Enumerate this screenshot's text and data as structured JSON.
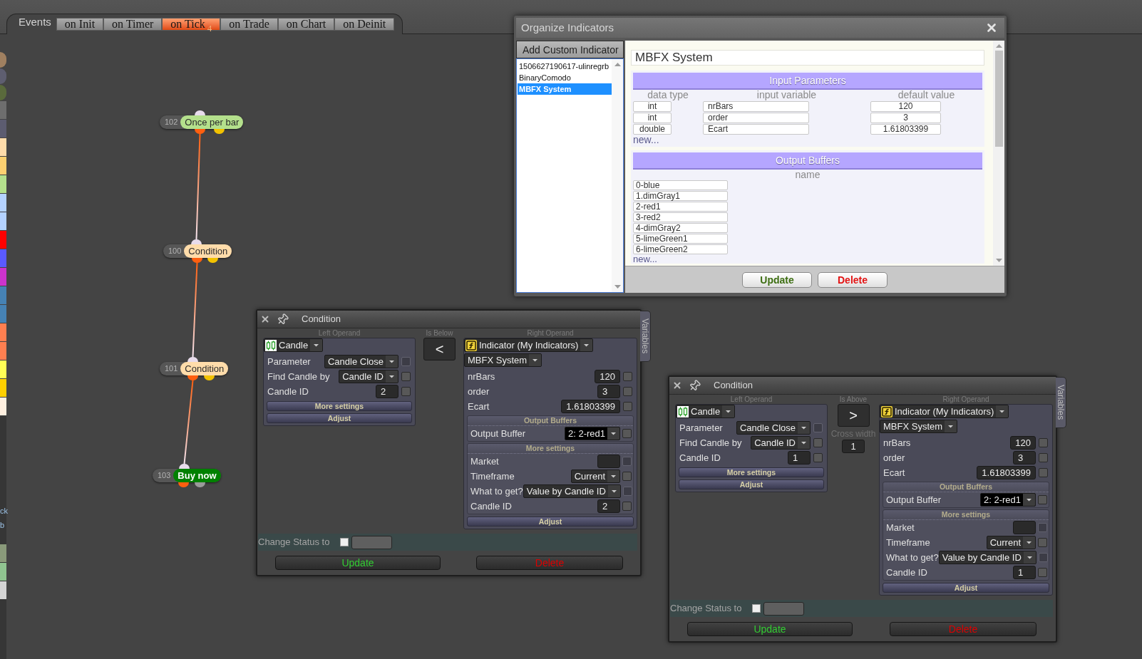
{
  "events_bar": {
    "label": "Events",
    "tabs": [
      {
        "label": "on Init",
        "selected": false
      },
      {
        "label": "on Timer",
        "selected": false
      },
      {
        "label": "on Tick",
        "selected": true,
        "badge": "4"
      },
      {
        "label": "on Trade",
        "selected": false
      },
      {
        "label": "on Chart",
        "selected": false
      },
      {
        "label": "on Deinit",
        "selected": false
      }
    ]
  },
  "palette": {
    "top": [
      {
        "kind": "dot",
        "color": "#a08060"
      },
      {
        "kind": "dot",
        "color": "#5e5e70"
      },
      {
        "kind": "dot",
        "color": "#5a6a3c"
      },
      {
        "kind": "swatch",
        "color": "#6e6e6e"
      },
      {
        "kind": "swatch",
        "color": "#5c5c70"
      },
      {
        "kind": "swatch",
        "color": "#ffdcaa"
      },
      {
        "kind": "swatch",
        "color": "#fcd070"
      },
      {
        "kind": "swatch",
        "color": "#b4e08c"
      },
      {
        "kind": "swatch",
        "color": "#b4d2ff"
      },
      {
        "kind": "swatch",
        "color": "#b4d2ff"
      },
      {
        "kind": "swatch",
        "color": "#ff0000"
      },
      {
        "kind": "swatch",
        "color": "#5a5aff"
      },
      {
        "kind": "swatch",
        "color": "#cc33cc"
      },
      {
        "kind": "swatch",
        "color": "#4682b4"
      },
      {
        "kind": "swatch",
        "color": "#4682b4"
      },
      {
        "kind": "swatch",
        "color": "#ff7f50"
      },
      {
        "kind": "swatch",
        "color": "#ff7f50"
      },
      {
        "kind": "swatch",
        "color": "#ffff55"
      },
      {
        "kind": "swatch",
        "color": "#ffd000"
      },
      {
        "kind": "swatch",
        "color": "#fff0e0"
      }
    ],
    "bottom": [
      {
        "kind": "text",
        "text": "ck"
      },
      {
        "kind": "text",
        "text": "b"
      },
      {
        "kind": "swatch",
        "color": "#8a9a7a"
      },
      {
        "kind": "swatch",
        "color": "#90c490"
      },
      {
        "kind": "swatch",
        "color": "#d4d4d4"
      }
    ]
  },
  "flow": {
    "nodes": [
      {
        "number": "102",
        "label": "Once per bar",
        "kind": "trigger",
        "color": "#b4e08c"
      },
      {
        "number": "100",
        "label": "Condition",
        "kind": "condition",
        "color": "#ffdcaa"
      },
      {
        "number": "101",
        "label": "Condition",
        "kind": "condition",
        "color": "#ffdcaa"
      },
      {
        "number": "103",
        "label": "Buy now",
        "kind": "action",
        "color": "#008000"
      }
    ]
  },
  "organize_window": {
    "title": "Organize Indicators",
    "add_button": "Add Custom Indicator",
    "indicators": [
      {
        "name": "1506627190617-ulinregrb",
        "selected": false
      },
      {
        "name": "BinaryComodo",
        "selected": false
      },
      {
        "name": "MBFX System",
        "selected": true
      }
    ],
    "name_field": "MBFX System",
    "input_parameters": {
      "title": "Input Parameters",
      "columns": [
        "data type",
        "input variable",
        "default value"
      ],
      "rows": [
        {
          "data_type": "int",
          "variable": "nrBars",
          "default": "120"
        },
        {
          "data_type": "int",
          "variable": "order",
          "default": "3"
        },
        {
          "data_type": "double",
          "variable": "Ecart",
          "default": "1.61803399"
        }
      ],
      "new_link": "new..."
    },
    "output_buffers": {
      "title": "Output Buffers",
      "column": "name",
      "rows": [
        "0-blue",
        "1.dimGray1",
        "2-red1",
        "3-red2",
        "4-dimGray2",
        "5-limeGreen1",
        "6-limeGreen2"
      ],
      "new_link": "new..."
    },
    "buttons": [
      {
        "kind": "update",
        "label": "Update"
      },
      {
        "kind": "delete",
        "label": "Delete"
      }
    ]
  },
  "condition_panels": [
    {
      "title": "Condition",
      "side_tab": "Variables",
      "left_operand": {
        "label": "Left Operand",
        "kind": "candle",
        "source": "Candle",
        "rows": [
          {
            "kind": "select",
            "label": "Parameter",
            "value": "Candle Close",
            "focused": false,
            "check_disabled": true
          },
          {
            "kind": "select",
            "label": "Find Candle by",
            "value": "Candle ID",
            "focused": false,
            "check_disabled": false
          },
          {
            "kind": "input",
            "label": "Candle ID",
            "value": "2",
            "check_disabled": false
          }
        ],
        "sections": [
          {
            "title": "More settings",
            "expanded": false
          },
          {
            "title": "Adjust",
            "expanded": false
          }
        ]
      },
      "operator": {
        "label": "Is Below",
        "symbol": "<"
      },
      "right_operand": {
        "label": "Right Operand",
        "kind": "indicator",
        "source": "Indicator (My Indicators)",
        "indicator": "MBFX System",
        "rows": [
          {
            "kind": "input",
            "label": "nrBars",
            "value": "120",
            "check_disabled": false
          },
          {
            "kind": "input",
            "label": "order",
            "value": "3",
            "check_disabled": false
          },
          {
            "kind": "input",
            "label": "Ecart",
            "value": "1.61803399",
            "check_disabled": false
          }
        ],
        "sections": [
          {
            "title": "Output Buffers",
            "expanded": true,
            "rows": [
              {
                "kind": "select",
                "label": "Output Buffer",
                "value": "2: 2-red1",
                "focused": true,
                "check_disabled": false
              }
            ]
          },
          {
            "title": "More settings",
            "expanded": true,
            "rows": [
              {
                "kind": "input",
                "label": "Market",
                "check_disabled": true
              },
              {
                "kind": "select",
                "label": "Timeframe",
                "value": "Current",
                "focused": false,
                "check_disabled": false
              },
              {
                "kind": "select",
                "label": "What to get?",
                "value": "Value by Candle ID",
                "focused": false,
                "check_disabled": true
              },
              {
                "kind": "input",
                "label": "Candle ID",
                "value": "2",
                "check_disabled": false
              }
            ]
          },
          {
            "title": "Adjust",
            "expanded": false
          }
        ]
      },
      "change_status": {
        "label": "Change Status to",
        "checked": false
      },
      "buttons": [
        {
          "kind": "update",
          "label": "Update"
        },
        {
          "kind": "delete",
          "label": "Delete"
        }
      ]
    },
    {
      "title": "Condition",
      "side_tab": "Variables",
      "left_operand": {
        "label": "Left Operand",
        "kind": "candle",
        "source": "Candle",
        "rows": [
          {
            "kind": "select",
            "label": "Parameter",
            "value": "Candle Close",
            "focused": false,
            "check_disabled": true
          },
          {
            "kind": "select",
            "label": "Find Candle by",
            "value": "Candle ID",
            "focused": false,
            "check_disabled": false
          },
          {
            "kind": "input",
            "label": "Candle ID",
            "value": "1",
            "check_disabled": false
          }
        ],
        "sections": [
          {
            "title": "More settings",
            "expanded": false
          },
          {
            "title": "Adjust",
            "expanded": false
          }
        ]
      },
      "operator": {
        "label": "Is Above",
        "symbol": ">",
        "cross_width": {
          "label": "Cross width",
          "value": "1"
        }
      },
      "right_operand": {
        "label": "Right Operand",
        "kind": "indicator",
        "source": "Indicator (My Indicators)",
        "indicator": "MBFX System",
        "rows": [
          {
            "kind": "input",
            "label": "nrBars",
            "value": "120",
            "check_disabled": false
          },
          {
            "kind": "input",
            "label": "order",
            "value": "3",
            "check_disabled": false
          },
          {
            "kind": "input",
            "label": "Ecart",
            "value": "1.61803399",
            "check_disabled": false
          }
        ],
        "sections": [
          {
            "title": "Output Buffers",
            "expanded": true,
            "rows": [
              {
                "kind": "select",
                "label": "Output Buffer",
                "value": "2: 2-red1",
                "focused": true,
                "check_disabled": false
              }
            ]
          },
          {
            "title": "More settings",
            "expanded": true,
            "rows": [
              {
                "kind": "input",
                "label": "Market",
                "check_disabled": true
              },
              {
                "kind": "select",
                "label": "Timeframe",
                "value": "Current",
                "focused": false,
                "check_disabled": false
              },
              {
                "kind": "select",
                "label": "What to get?",
                "value": "Value by Candle ID",
                "focused": false,
                "check_disabled": true
              },
              {
                "kind": "input",
                "label": "Candle ID",
                "value": "1",
                "check_disabled": false
              }
            ]
          },
          {
            "title": "Adjust",
            "expanded": false
          }
        ]
      },
      "change_status": {
        "label": "Change Status to",
        "checked": false
      },
      "buttons": [
        {
          "kind": "update",
          "label": "Update"
        },
        {
          "kind": "delete",
          "label": "Delete"
        }
      ]
    }
  ]
}
